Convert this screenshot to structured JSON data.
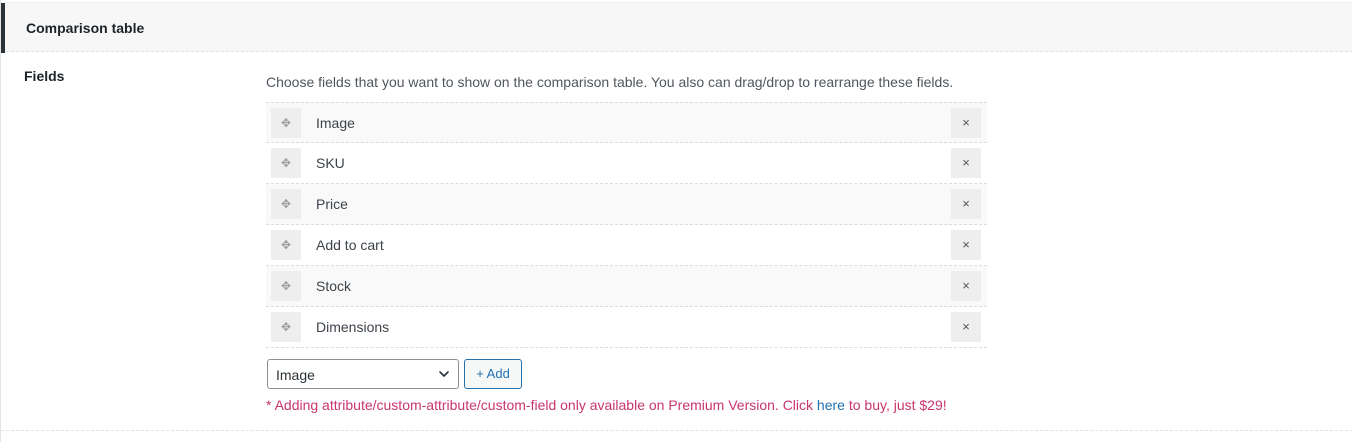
{
  "section": {
    "title": "Comparison table"
  },
  "fields": {
    "label": "Fields",
    "description": "Choose fields that you want to show on the comparison table. You also can drag/drop to rearrange these fields.",
    "items": [
      {
        "label": "Image"
      },
      {
        "label": "SKU"
      },
      {
        "label": "Price"
      },
      {
        "label": "Add to cart"
      },
      {
        "label": "Stock"
      },
      {
        "label": "Dimensions"
      }
    ],
    "handle_glyph": "✥",
    "remove_glyph": "×",
    "select": {
      "value": "Image"
    },
    "add_button": "+ Add",
    "note": {
      "prefix": "* Adding attribute/custom-attribute/custom-field only available on Premium Version. Click ",
      "link": "here",
      "suffix": " to buy, just $29!"
    }
  },
  "colors": {
    "accent": "#2271b1",
    "note": "#c9356e",
    "header_bar": "#2c3338"
  }
}
